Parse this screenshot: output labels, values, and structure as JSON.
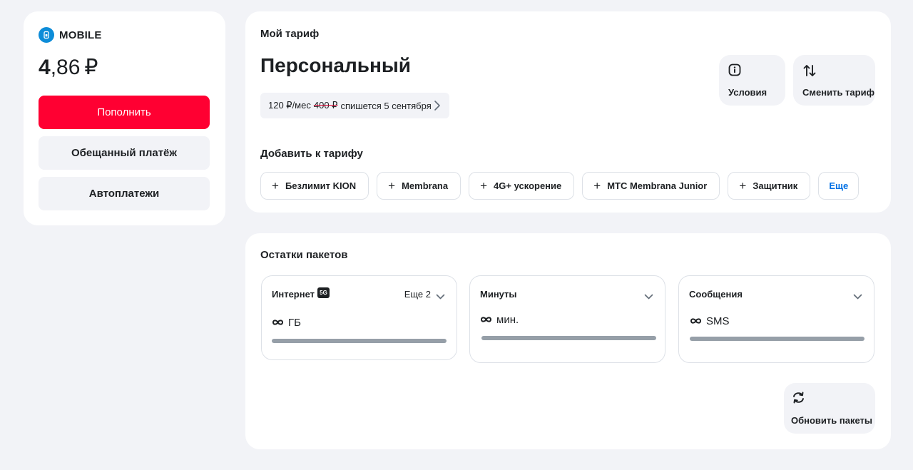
{
  "account": {
    "name": "MOBILE",
    "balance_int": "4",
    "balance_dec": ",86",
    "currency": "₽"
  },
  "balance_actions": {
    "topup": "Пополнить",
    "promised": "Обещанный платёж",
    "autopay": "Автоплатежи"
  },
  "tariff": {
    "section_title": "Мой тариф",
    "name": "Персональный",
    "price_new": "120 ₽/мес",
    "price_old": "400 ₽",
    "price_note": "спишется 5 сентября",
    "conditions_label": "Условия",
    "change_label": "Сменить тариф"
  },
  "addons": {
    "title": "Добавить к тарифу",
    "items": [
      "Безлимит KION",
      "Membrana",
      "4G+ ускорение",
      "МТС Membrana Junior",
      "Защитник"
    ],
    "more": "Еще"
  },
  "packages": {
    "title": "Остатки пакетов",
    "internet": {
      "title": "Интернет",
      "badge": "5G",
      "more": "Еще 2",
      "unit": "ГБ"
    },
    "minutes": {
      "title": "Минуты",
      "unit": "мин."
    },
    "sms": {
      "title": "Сообщения",
      "unit": "SMS"
    },
    "refresh_label": "Обновить пакеты"
  },
  "colors": {
    "brand_red": "#ff0032",
    "link_blue": "#0070e5",
    "background": "#f2f3f7",
    "bar_grey": "#969fa8"
  },
  "icons": {
    "account": "sim-icon",
    "conditions": "info-icon",
    "change": "swap-arrows-icon",
    "refresh": "refresh-icon",
    "unlimited": "infinity-icon"
  }
}
